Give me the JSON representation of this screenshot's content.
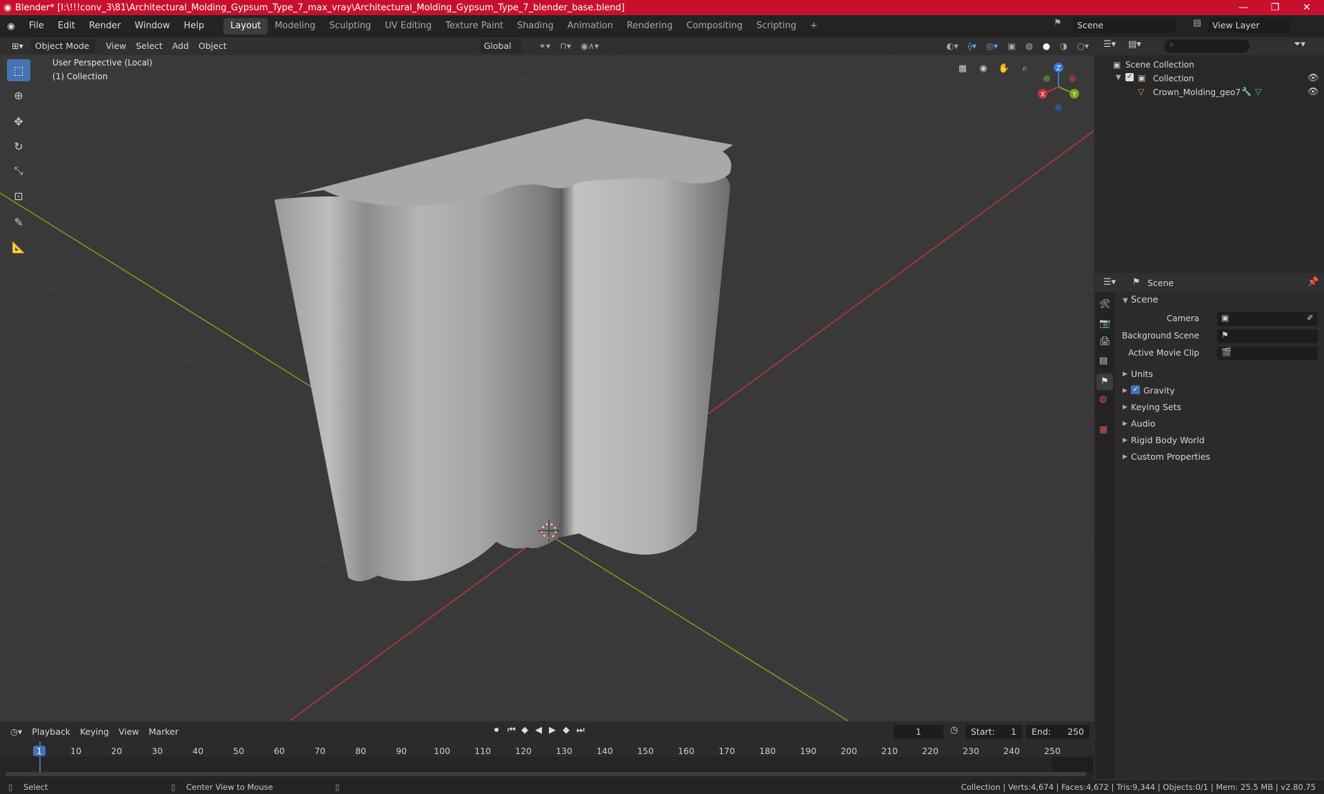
{
  "window": {
    "title": "Blender* [I:\\!!!conv_3\\81\\Architectural_Molding_Gypsum_Type_7_max_vray\\Architectural_Molding_Gypsum_Type_7_blender_base.blend]",
    "minimize": "—",
    "maximize": "❐",
    "close": "✕"
  },
  "menu": {
    "items": [
      "File",
      "Edit",
      "Render",
      "Window",
      "Help"
    ]
  },
  "workspaces": {
    "tabs": [
      "Layout",
      "Modeling",
      "Sculpting",
      "UV Editing",
      "Texture Paint",
      "Shading",
      "Animation",
      "Rendering",
      "Compositing",
      "Scripting"
    ],
    "active": "Layout",
    "add": "+"
  },
  "scene_selector": {
    "value": "Scene"
  },
  "view_layer": {
    "value": "View Layer"
  },
  "viewport_header": {
    "mode": "Object Mode",
    "menus": [
      "View",
      "Select",
      "Add",
      "Object"
    ],
    "transform": "Global"
  },
  "viewport": {
    "perspective": "User Perspective (Local)",
    "collection": "(1) Collection"
  },
  "gizmo": {
    "z": "Z",
    "y": "Y",
    "x": "X"
  },
  "outliner": {
    "root": "Scene Collection",
    "collection": "Collection",
    "object": "Crown_Molding_geo7"
  },
  "properties": {
    "context": "Scene",
    "section": "Scene",
    "camera_label": "Camera",
    "background_label": "Background Scene",
    "movie_clip_label": "Active Movie Clip",
    "panels": [
      "Units",
      "Gravity",
      "Keying Sets",
      "Audio",
      "Rigid Body World",
      "Custom Properties"
    ]
  },
  "timeline_header": {
    "menus": [
      "Playback",
      "Keying",
      "View",
      "Marker"
    ],
    "current_frame": "1",
    "start_label": "Start:",
    "start": "1",
    "end_label": "End:",
    "end": "250"
  },
  "timeline": {
    "ticks": [
      "1",
      "10",
      "20",
      "30",
      "40",
      "50",
      "60",
      "70",
      "80",
      "90",
      "100",
      "110",
      "120",
      "130",
      "140",
      "150",
      "160",
      "170",
      "180",
      "190",
      "200",
      "210",
      "220",
      "230",
      "240",
      "250"
    ]
  },
  "statusbar": {
    "select": "Select",
    "center": "Center View to Mouse",
    "stats": "Collection | Verts:4,674 | Faces:4,672 | Tris:9,344 | Objects:0/1 | Mem: 25.5 MB | v2.80.75"
  },
  "colors": {
    "title": "#c8102e",
    "accent": "#4772b3",
    "x_axis": "#c8323c",
    "y_axis": "#7ea11a",
    "z_axis": "#2f7bd6"
  }
}
